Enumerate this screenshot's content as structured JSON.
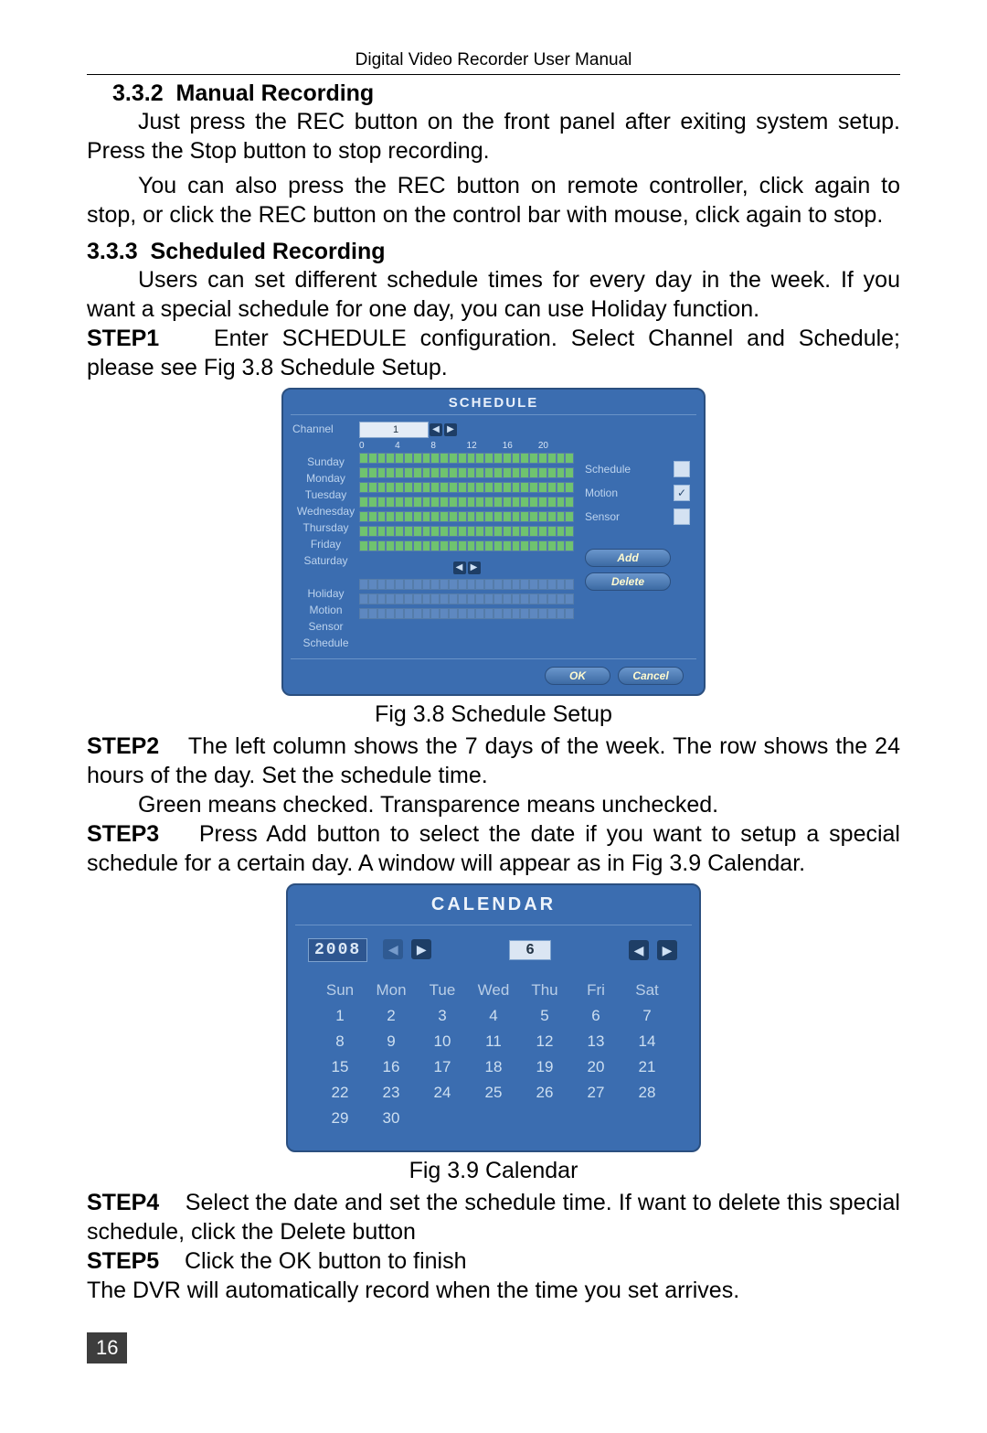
{
  "header": {
    "title": "Digital Video Recorder User Manual"
  },
  "sec1": {
    "num": "3.3.2",
    "title": "Manual Recording",
    "p1": "Just press the REC button on the front panel after exiting system setup. Press the Stop button to stop recording.",
    "p2": "You can also press the REC button on remote controller, click again to stop, or click the REC button on the control bar with mouse, click again to stop."
  },
  "sec2": {
    "num": "3.3.3",
    "title": "Scheduled Recording",
    "p1": "Users can set different schedule times for every day in the week. If you want a special schedule for one day, you can use Holiday function.",
    "step1_label": "STEP1",
    "step1_text": "Enter SCHEDULE configuration. Select Channel and Schedule; please see Fig 3.8 Schedule Setup.",
    "fig1_caption": "Fig 3.8 Schedule Setup",
    "step2_label": "STEP2",
    "step2_text_a": "The left column shows the 7 days of the week. The row shows the 24 hours of the day. Set the schedule time.",
    "step2_text_b": "Green means checked. Transparence means unchecked.",
    "step3_label": "STEP3",
    "step3_text": "Press Add button to select the date if you want to setup a special schedule for a certain day. A window will appear as in Fig 3.9   Calendar.",
    "fig2_caption": "Fig 3.9   Calendar",
    "step4_label": "STEP4",
    "step4_text": "Select the date and set the schedule time. If want to delete this special schedule, click the Delete button",
    "step5_label": "STEP5",
    "step5_text": "Click the OK button to finish",
    "closing": "The DVR will automatically record when the time you set arrives."
  },
  "schedule_ui": {
    "title": "SCHEDULE",
    "channel_label": "Channel",
    "channel_value": "1",
    "hour_ticks": [
      "0",
      "4",
      "8",
      "12",
      "16",
      "20"
    ],
    "days": [
      "Sunday",
      "Monday",
      "Tuesday",
      "Wednesday",
      "Thursday",
      "Friday",
      "Saturday"
    ],
    "extra_rows": [
      "Holiday",
      "Motion",
      "Sensor",
      "Schedule"
    ],
    "options": [
      {
        "label": "Schedule",
        "checked": false
      },
      {
        "label": "Motion",
        "checked": true
      },
      {
        "label": "Sensor",
        "checked": false
      }
    ],
    "buttons": {
      "add": "Add",
      "delete": "Delete",
      "ok": "OK",
      "cancel": "Cancel"
    }
  },
  "calendar_ui": {
    "title": "CALENDAR",
    "year": "2008",
    "month": "6",
    "dow": [
      "Sun",
      "Mon",
      "Tue",
      "Wed",
      "Thu",
      "Fri",
      "Sat"
    ],
    "grid": [
      [
        "1",
        "2",
        "3",
        "4",
        "5",
        "6",
        "7"
      ],
      [
        "8",
        "9",
        "10",
        "11",
        "12",
        "13",
        "14"
      ],
      [
        "15",
        "16",
        "17",
        "18",
        "19",
        "20",
        "21"
      ],
      [
        "22",
        "23",
        "24",
        "25",
        "26",
        "27",
        "28"
      ],
      [
        "29",
        "30",
        "",
        "",
        "",
        "",
        ""
      ]
    ]
  },
  "page_number": "16"
}
